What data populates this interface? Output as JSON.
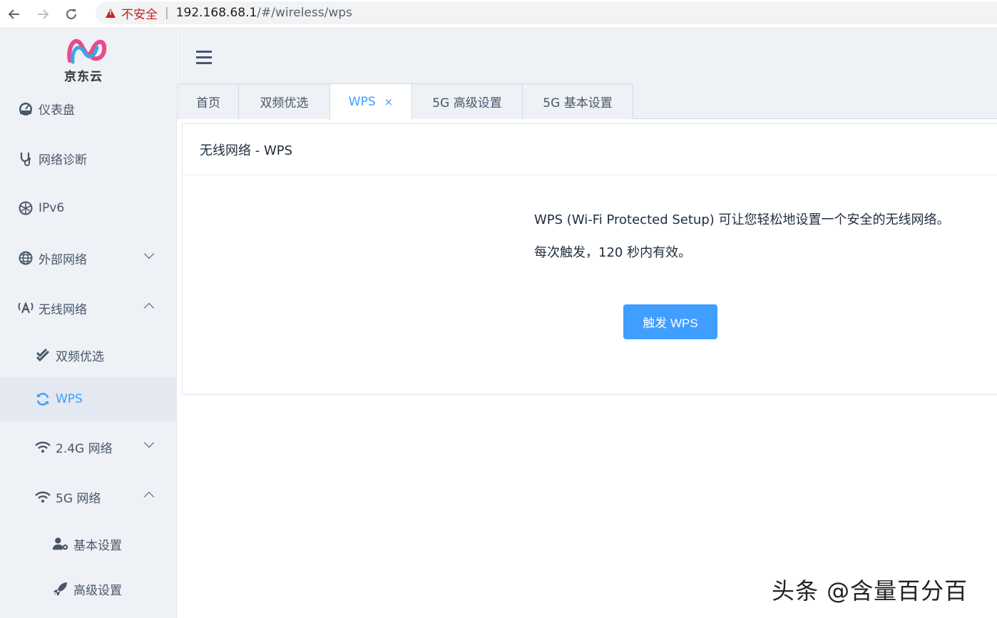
{
  "browser": {
    "insecure_label": "不安全",
    "separator": "|",
    "url_host": "192.168.68.1",
    "url_path": "/#/wireless/wps"
  },
  "logo": {
    "text": "京东云"
  },
  "sidebar": {
    "items": [
      {
        "label": "仪表盘",
        "icon": "dashboard-icon"
      },
      {
        "label": "网络诊断",
        "icon": "stethoscope-icon"
      },
      {
        "label": "IPv6",
        "icon": "network-globe-icon"
      },
      {
        "label": "外部网络",
        "icon": "globe-icon",
        "expanded": false
      },
      {
        "label": "无线网络",
        "icon": "antenna-icon",
        "expanded": true
      },
      {
        "label": "双频优选",
        "icon": "double-check-icon"
      },
      {
        "label": "WPS",
        "icon": "sync-icon",
        "active": true
      },
      {
        "label": "2.4G 网络",
        "icon": "wifi-icon",
        "expanded": false
      },
      {
        "label": "5G 网络",
        "icon": "wifi-icon",
        "expanded": true
      },
      {
        "label": "基本设置",
        "icon": "user-gear-icon"
      },
      {
        "label": "高级设置",
        "icon": "rocket-icon"
      }
    ]
  },
  "tabs": [
    {
      "label": "首页"
    },
    {
      "label": "双频优选"
    },
    {
      "label": "WPS",
      "active": true,
      "close": "×"
    },
    {
      "label": "5G 高级设置"
    },
    {
      "label": "5G 基本设置"
    }
  ],
  "panel": {
    "title": "无线网络 - WPS",
    "description_1": "WPS (Wi-Fi Protected Setup) 可让您轻松地设置一个安全的无线网络。",
    "description_2": "每次触发，120 秒内有效。",
    "button_label": "触发 WPS"
  },
  "watermark": "头条 @含量百分百",
  "colors": {
    "accent": "#409eff",
    "sidebar_bg": "#eef1f6",
    "warning": "#c5221f"
  }
}
